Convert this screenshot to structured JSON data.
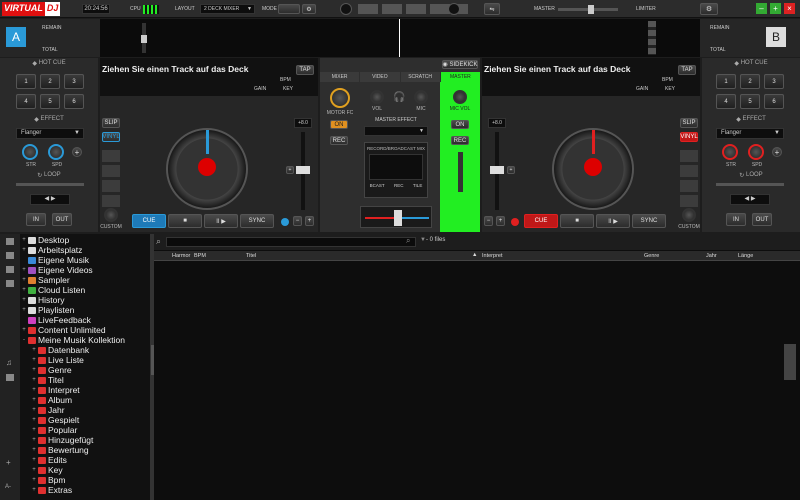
{
  "app": {
    "logo_a": "VIRTUAL",
    "logo_b": "DJ",
    "time": "20:24:56",
    "cpu": "CPU",
    "layout": "LAYOUT",
    "layout_value": "2 DECK MIXER",
    "mode": "MODE",
    "master": "MASTER",
    "limiter": "LIMITER"
  },
  "decks": {
    "a": {
      "letter": "A",
      "remain": "REMAIN",
      "total": "TOTAL",
      "title": "Ziehen Sie einen Track auf das Deck",
      "tap": "TAP",
      "bpm": "BPM",
      "gain": "GAIN",
      "key": "KEY",
      "slip": "SLIP",
      "vinyl": "VINYL",
      "pitch": "+8.0",
      "cue": "CUE",
      "stop": "■",
      "play": "II ▶",
      "sync": "SYNC",
      "custom": "CUSTOM"
    },
    "b": {
      "letter": "B",
      "remain": "REMAIN",
      "total": "TOTAL",
      "title": "Ziehen Sie einen Track auf das Deck",
      "tap": "TAP",
      "bpm": "BPM",
      "gain": "GAIN",
      "key": "KEY",
      "slip": "SLIP",
      "vinyl": "VINYL",
      "pitch": "+8.0",
      "cue": "CUE",
      "stop": "■",
      "play": "II ▶",
      "sync": "SYNC",
      "custom": "CUSTOM"
    }
  },
  "side": {
    "hotcue": "HOT CUE",
    "effect": "EFFECT",
    "loop": "LOOP",
    "effect_name": "Flanger",
    "str": "STR",
    "spd": "SPD",
    "in": "IN",
    "out": "OUT",
    "pads": [
      "1",
      "2",
      "3",
      "4",
      "5",
      "6"
    ]
  },
  "mixer": {
    "tabs": [
      "MIXER",
      "VIDEO",
      "SCRATCH",
      "MASTER"
    ],
    "sidekick": "SIDEKICK",
    "motor": "MOTOR FC",
    "vol": "VOL",
    "mic": "MIC",
    "micvol": "MIC VOL",
    "on": "ON",
    "rec": "REC",
    "master_effect": "MASTER EFFECT",
    "record": "RECORD/BROADCAST MIX",
    "bcast": "BCAST",
    "rec2": "REC",
    "tile": "TILE"
  },
  "browser": {
    "files": "0 files",
    "columns": [
      "Harmor",
      "BPM",
      "Titel",
      "Interpret",
      "Genre",
      "Jahr",
      "Länge"
    ],
    "tree": [
      {
        "label": "Desktop",
        "level": 0,
        "exp": "+",
        "color": "#ddd"
      },
      {
        "label": "Arbeitsplatz",
        "level": 0,
        "exp": "+",
        "color": "#ddd"
      },
      {
        "label": "Eigene Musik",
        "level": 0,
        "exp": "",
        "color": "#3a8ad8"
      },
      {
        "label": "Eigene Videos",
        "level": 0,
        "exp": "+",
        "color": "#a050c0"
      },
      {
        "label": "Sampler",
        "level": 0,
        "exp": "+",
        "color": "#e08030"
      },
      {
        "label": "Cloud Listen",
        "level": 0,
        "exp": "+",
        "color": "#40b040"
      },
      {
        "label": "History",
        "level": 0,
        "exp": "+",
        "color": "#ddd"
      },
      {
        "label": "Playlisten",
        "level": 0,
        "exp": "+",
        "color": "#ddd"
      },
      {
        "label": "LiveFeedback",
        "level": 0,
        "exp": "",
        "color": "#d040c0"
      },
      {
        "label": "Content Unlimited",
        "level": 0,
        "exp": "+",
        "color": "#e03030"
      },
      {
        "label": "Meine Musik Kollektion",
        "level": 0,
        "exp": "-",
        "color": "#e03030"
      },
      {
        "label": "Datenbank",
        "level": 1,
        "exp": "+",
        "color": "#e03030"
      },
      {
        "label": "Live Liste",
        "level": 1,
        "exp": "+",
        "color": "#e03030"
      },
      {
        "label": "Genre",
        "level": 1,
        "exp": "+",
        "color": "#e03030"
      },
      {
        "label": "Titel",
        "level": 1,
        "exp": "+",
        "color": "#e03030"
      },
      {
        "label": "Interpret",
        "level": 1,
        "exp": "+",
        "color": "#e03030"
      },
      {
        "label": "Album",
        "level": 1,
        "exp": "+",
        "color": "#e03030"
      },
      {
        "label": "Jahr",
        "level": 1,
        "exp": "+",
        "color": "#e03030"
      },
      {
        "label": "Gespielt",
        "level": 1,
        "exp": "+",
        "color": "#e03030"
      },
      {
        "label": "Popular",
        "level": 1,
        "exp": "+",
        "color": "#e03030"
      },
      {
        "label": "Hinzugefügt",
        "level": 1,
        "exp": "+",
        "color": "#e03030"
      },
      {
        "label": "Bewertung",
        "level": 1,
        "exp": "+",
        "color": "#e03030"
      },
      {
        "label": "Edits",
        "level": 1,
        "exp": "+",
        "color": "#e03030"
      },
      {
        "label": "Key",
        "level": 1,
        "exp": "+",
        "color": "#e03030"
      },
      {
        "label": "Bpm",
        "level": 1,
        "exp": "+",
        "color": "#e03030"
      },
      {
        "label": "Extras",
        "level": 1,
        "exp": "+",
        "color": "#e03030"
      }
    ]
  },
  "colors": {
    "deck_a": "#2a9ad8",
    "deck_b": "#e02020",
    "master_highlight": "#22ee22"
  }
}
